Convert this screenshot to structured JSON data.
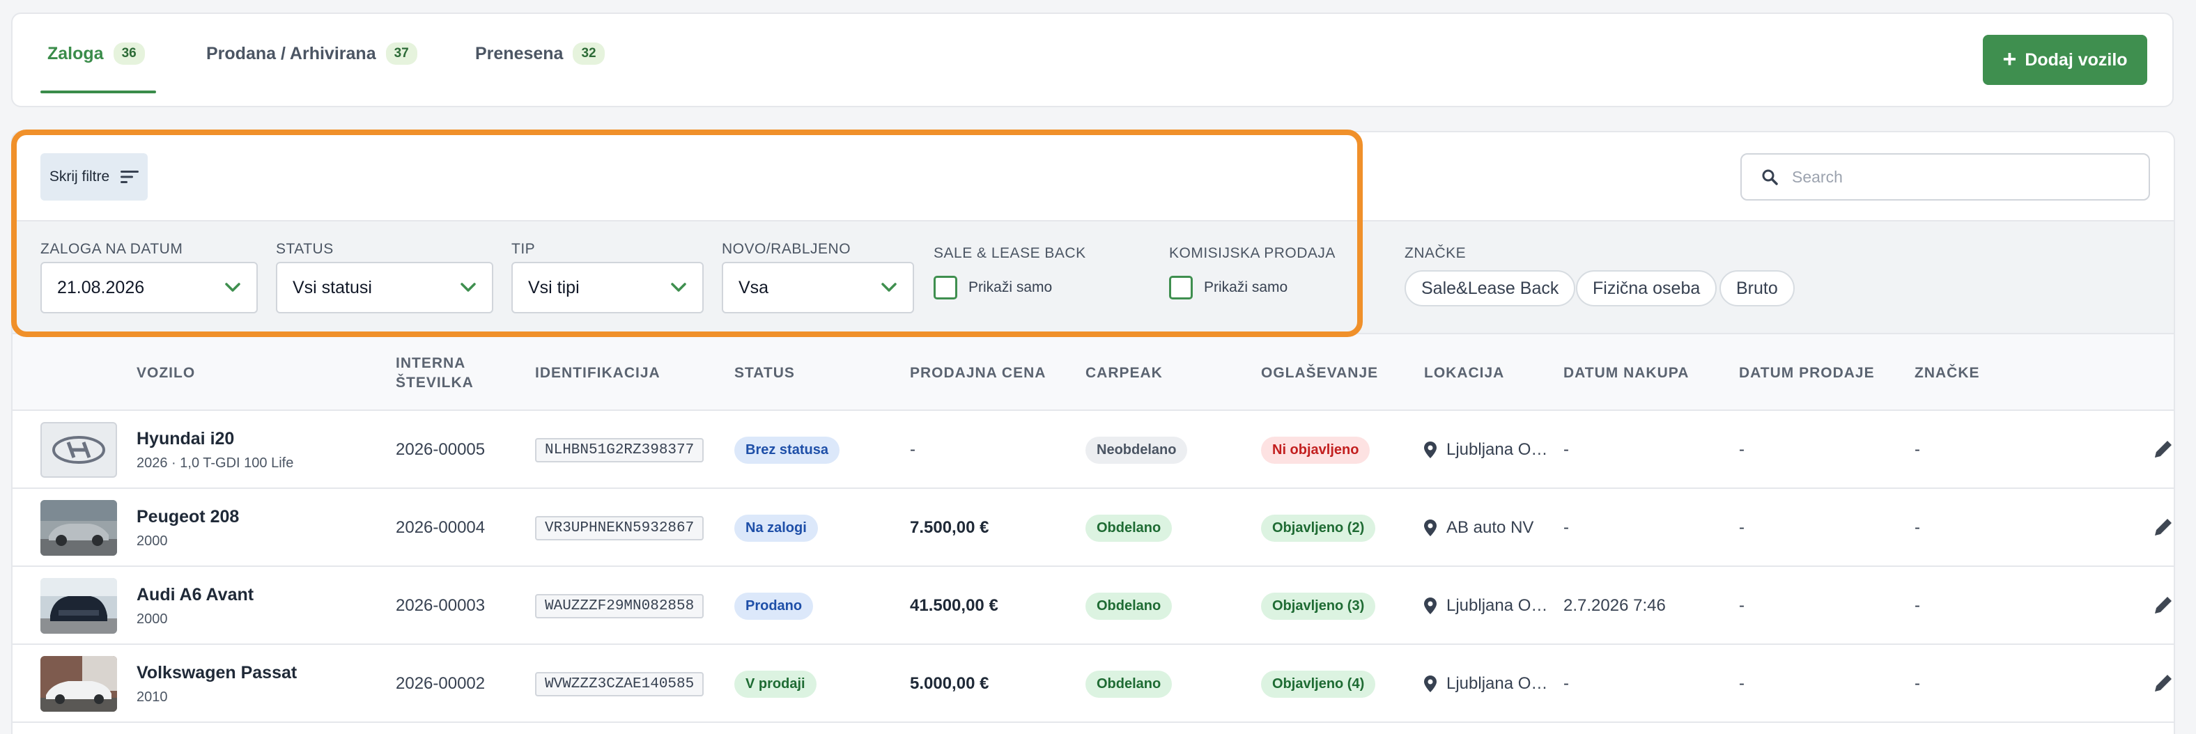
{
  "tabs": [
    {
      "label": "Zaloga",
      "count": "36",
      "active": true
    },
    {
      "label": "Prodana / Arhivirana",
      "count": "37",
      "active": false
    },
    {
      "label": "Prenesena",
      "count": "32",
      "active": false
    }
  ],
  "add_button": {
    "label": "Dodaj vozilo",
    "icon": "plus-icon"
  },
  "toggle_filters": {
    "label": "Skrij filtre",
    "icon": "filter-lines-icon"
  },
  "search": {
    "placeholder": "Search",
    "value": "",
    "icon": "search-icon"
  },
  "filters": {
    "stock_date": {
      "label": "ZALOGA NA DATUM",
      "value": "21.08.2026"
    },
    "status": {
      "label": "STATUS",
      "value": "Vsi statusi"
    },
    "type": {
      "label": "TIP",
      "value": "Vsi tipi"
    },
    "condition": {
      "label": "NOVO/RABLJENO",
      "value": "Vsa"
    },
    "sale_lease_back": {
      "label": "SALE & LEASE BACK",
      "checkbox_label": "Prikaži samo"
    },
    "consignment": {
      "label": "KOMISIJSKA PRODAJA",
      "checkbox_label": "Prikaži samo"
    },
    "tags": {
      "label": "ZNAČKE",
      "items": [
        "Sale&Lease Back",
        "Fizična oseba",
        "Bruto"
      ]
    }
  },
  "table": {
    "headers": {
      "vehicle": "VOZILO",
      "internal_1": "INTERNA",
      "internal_2": "ŠTEVILKA",
      "identification": "IDENTIFIKACIJA",
      "status": "STATUS",
      "price": "PRODAJNA CENA",
      "carpeak": "CARPEAK",
      "advertising": "OGLAŠEVANJE",
      "location": "LOKACIJA",
      "purchase_date": "DATUM NAKUPA",
      "sale_date": "DATUM PRODAJE",
      "tags": "ZNAČKE"
    },
    "rows": [
      {
        "name": "Hyundai i20",
        "sub": "2026 · 1,0 T-GDI 100 Life",
        "internal": "2026-00005",
        "vin": "NLHBN51G2RZ398377",
        "status": "Brez statusa",
        "price": "-",
        "carpeak": "Neobdelano",
        "advertising": "Ni objavljeno",
        "location": "Ljubljana O…",
        "purchase_date": "-",
        "sale_date": "-",
        "tags": "-"
      },
      {
        "name": "Peugeot 208",
        "sub": "2000",
        "internal": "2026-00004",
        "vin": "VR3UPHNEKN5932867",
        "status": "Na zalogi",
        "price": "7.500,00 €",
        "carpeak": "Obdelano",
        "advertising": "Objavljeno (2)",
        "location": "AB auto NV",
        "purchase_date": "-",
        "sale_date": "-",
        "tags": "-"
      },
      {
        "name": "Audi A6 Avant",
        "sub": "2000",
        "internal": "2026-00003",
        "vin": "WAUZZZF29MN082858",
        "status": "Prodano",
        "price": "41.500,00 €",
        "carpeak": "Obdelano",
        "advertising": "Objavljeno (3)",
        "location": "Ljubljana O…",
        "purchase_date": "2.7.2026 7:46",
        "sale_date": "-",
        "tags": "-"
      },
      {
        "name": "Volkswagen Passat",
        "sub": "2010",
        "internal": "2026-00002",
        "vin": "WVWZZZ3CZAE140585",
        "status": "V prodaji",
        "price": "5.000,00 €",
        "carpeak": "Obdelano",
        "advertising": "Objavljeno (4)",
        "location": "Ljubljana O…",
        "purchase_date": "-",
        "sale_date": "-",
        "tags": "-"
      }
    ]
  },
  "colors": {
    "accent": "#3f8f4f",
    "highlight": "#f0902a"
  }
}
